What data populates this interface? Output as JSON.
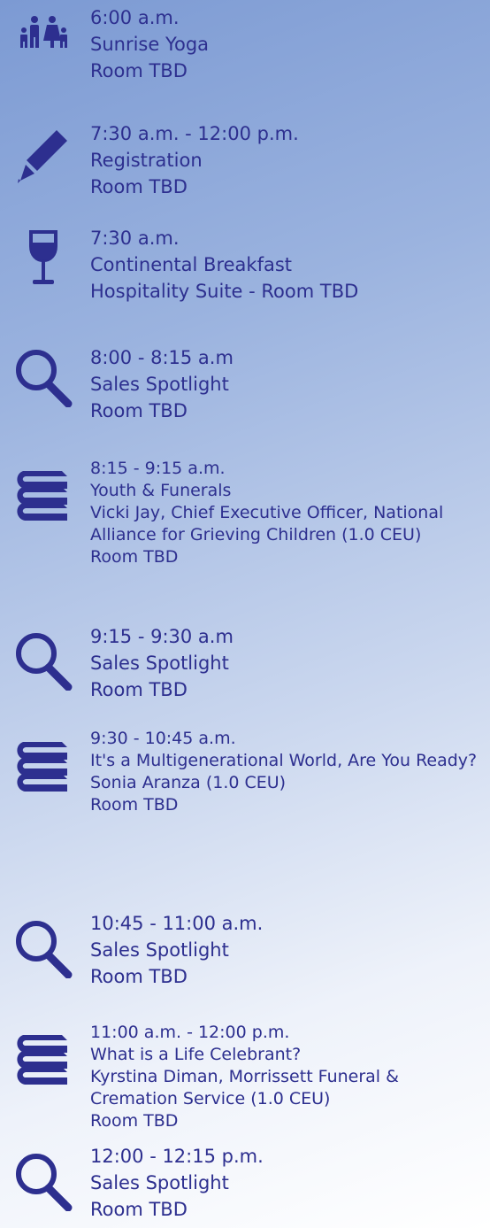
{
  "schedule": [
    {
      "icon": "family-icon",
      "time": "6:00 a.m.",
      "title": "Sunrise Yoga",
      "room": "Room TBD"
    },
    {
      "icon": "pencil-icon",
      "time": "7:30 a.m. - 12:00 p.m.",
      "title": "Registration",
      "room": "Room TBD"
    },
    {
      "icon": "wine-glass-icon",
      "time": "7:30 a.m.",
      "title": "Continental Breakfast",
      "room": "Hospitality Suite - Room TBD"
    },
    {
      "icon": "search-icon",
      "time": "8:00 - 8:15 a.m",
      "title": "Sales Spotlight",
      "room": "Room TBD"
    },
    {
      "icon": "books-icon",
      "time": "8:15 - 9:15 a.m.",
      "title": "Youth & Funerals",
      "speaker": "Vicki Jay, Chief Executive Officer, National Alliance for Grieving Children (1.0 CEU)",
      "room": "Room TBD"
    },
    {
      "icon": "search-icon",
      "time": "9:15 - 9:30 a.m",
      "title": "Sales Spotlight",
      "room": "Room TBD"
    },
    {
      "icon": "books-icon",
      "time": "9:30 - 10:45 a.m.",
      "title": "It's a Multigenerational World, Are You Ready?",
      "speaker": "Sonia Aranza (1.0 CEU)",
      "room": "Room TBD"
    },
    {
      "icon": "search-icon",
      "time": "10:45 - 11:00 a.m.",
      "title": "Sales Spotlight",
      "room": "Room TBD"
    },
    {
      "icon": "books-icon",
      "time": "11:00 a.m. - 12:00 p.m.",
      "title": "What is a Life Celebrant?",
      "speaker": "Kyrstina Diman, Morrissett Funeral & Cremation Service (1.0 CEU)",
      "room": "Room TBD"
    },
    {
      "icon": "search-icon",
      "time": "12:00 - 12:15 p.m.",
      "title": "Sales Spotlight",
      "room": "Room TBD"
    }
  ]
}
